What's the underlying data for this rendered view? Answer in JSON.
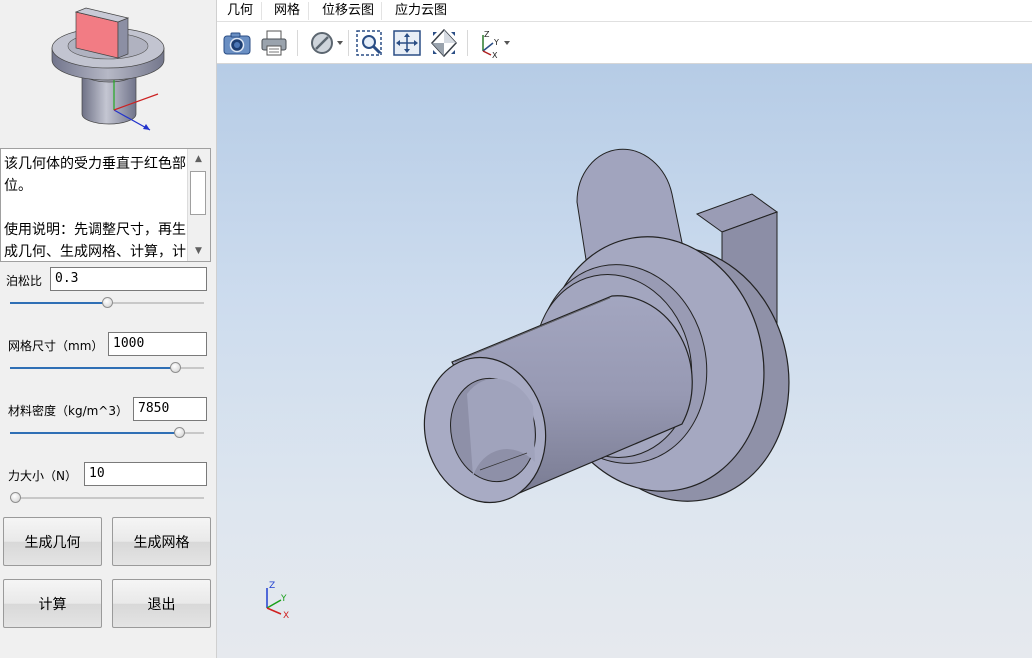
{
  "description": {
    "paragraph1": "该几何体的受力垂直于红色部位。",
    "paragraph2": "使用说明：先调整尺寸，再生成几何、生成网格、计算，计算完成后可在右方查看结果。"
  },
  "params": [
    {
      "label": "泊松比",
      "value": "0.3",
      "slider_fraction": 0.5
    },
    {
      "label": "网格尺寸（mm）",
      "value": "1000",
      "slider_fraction": 0.85
    },
    {
      "label": "材料密度（kg/m^3）",
      "value": "7850",
      "slider_fraction": 0.87
    },
    {
      "label": "力大小（N）",
      "value": "10",
      "slider_fraction": 0.0
    }
  ],
  "buttons": {
    "generate_geometry": "生成几何",
    "generate_mesh": "生成网格",
    "compute": "计算",
    "exit": "退出"
  },
  "menu": [
    "几何",
    "网格",
    "位移云图",
    "应力云图"
  ],
  "toolbar_icons": [
    "camera-icon",
    "print-icon",
    "hide-icon",
    "zoom-window-icon",
    "fit-all-icon",
    "view-cube-icon",
    "axes-icon"
  ],
  "axis_labels": {
    "x": "X",
    "y": "Y",
    "z": "Z"
  },
  "colors": {
    "highlight_face": "#f27c84",
    "model": "#9a9db5",
    "slider_fill": "#2f6fb5"
  }
}
